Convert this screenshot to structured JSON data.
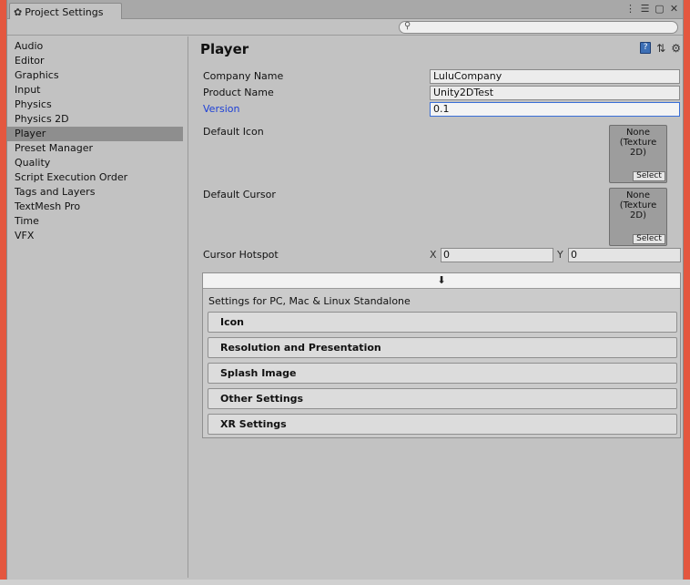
{
  "window": {
    "tab_label": "Project Settings",
    "tab_icon": "gear-icon",
    "controls": [
      "⋮",
      "☰",
      "▢",
      "✕"
    ]
  },
  "search": {
    "placeholder": "",
    "value": ""
  },
  "sidebar": {
    "items": [
      {
        "label": "Audio"
      },
      {
        "label": "Editor"
      },
      {
        "label": "Graphics"
      },
      {
        "label": "Input"
      },
      {
        "label": "Physics"
      },
      {
        "label": "Physics 2D"
      },
      {
        "label": "Player",
        "selected": true
      },
      {
        "label": "Preset Manager"
      },
      {
        "label": "Quality"
      },
      {
        "label": "Script Execution Order"
      },
      {
        "label": "Tags and Layers"
      },
      {
        "label": "TextMesh Pro"
      },
      {
        "label": "Time"
      },
      {
        "label": "VFX"
      }
    ]
  },
  "player": {
    "title": "Player",
    "company_label": "Company Name",
    "company_value": "LuluCompany",
    "product_label": "Product Name",
    "product_value": "Unity2DTest",
    "version_label": "Version",
    "version_value": "0.1",
    "default_icon_label": "Default Icon",
    "default_cursor_label": "Default Cursor",
    "texture_none_line1": "None",
    "texture_none_line2": "(Texture",
    "texture_none_line3": "2D)",
    "select_label": "Select",
    "cursor_hotspot_label": "Cursor Hotspot",
    "hotspot_x_label": "X",
    "hotspot_x_value": "0",
    "hotspot_y_label": "Y",
    "hotspot_y_value": "0"
  },
  "platform": {
    "tab_icon": "download-icon",
    "title": "Settings for PC, Mac & Linux Standalone",
    "sections": [
      {
        "label": "Icon"
      },
      {
        "label": "Resolution and Presentation"
      },
      {
        "label": "Splash Image"
      },
      {
        "label": "Other Settings"
      },
      {
        "label": "XR Settings"
      }
    ]
  },
  "colors": {
    "background": "#e4573f",
    "panel": "#c2c2c2",
    "selection": "#8e8e8e",
    "link_blue": "#1c3fd6"
  }
}
